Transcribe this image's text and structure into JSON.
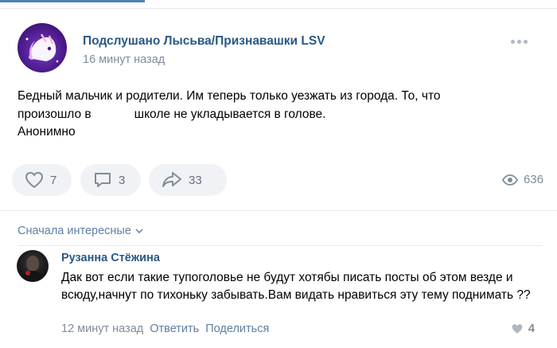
{
  "post": {
    "author": "Подслушано Лысьва/Признавашки LSV",
    "time": "16 минут назад",
    "text_lines": [
      "Бедный мальчик и родители. Им теперь только уезжать из города. То, что",
      "школе не укладывается в голове.",
      "Анонимно"
    ],
    "text_line2_prefix": "произошло в",
    "likes": "7",
    "comments": "3",
    "shares": "33",
    "views": "636"
  },
  "comments_section": {
    "sort_label": "Сначала интересные"
  },
  "comment": {
    "author": "Рузанна Стёжина",
    "text": "Дак вот если такие тупоголовье не будут хотябы писать посты об этом везде и всюду,начнут по тихоньку забывать.Вам видать нравиться эту тему поднимать ??",
    "time": "12 минут назад",
    "reply_label": "Ответить",
    "share_label": "Поделиться",
    "likes": "4"
  },
  "colors": {
    "accent": "#2a5885",
    "link": "#5f7fa3",
    "muted": "#818c99",
    "button_bg": "#f0f2f5"
  },
  "icons": [
    "more-icon",
    "heart-icon",
    "comment-icon",
    "share-icon",
    "eye-icon",
    "chevron-down-icon"
  ]
}
